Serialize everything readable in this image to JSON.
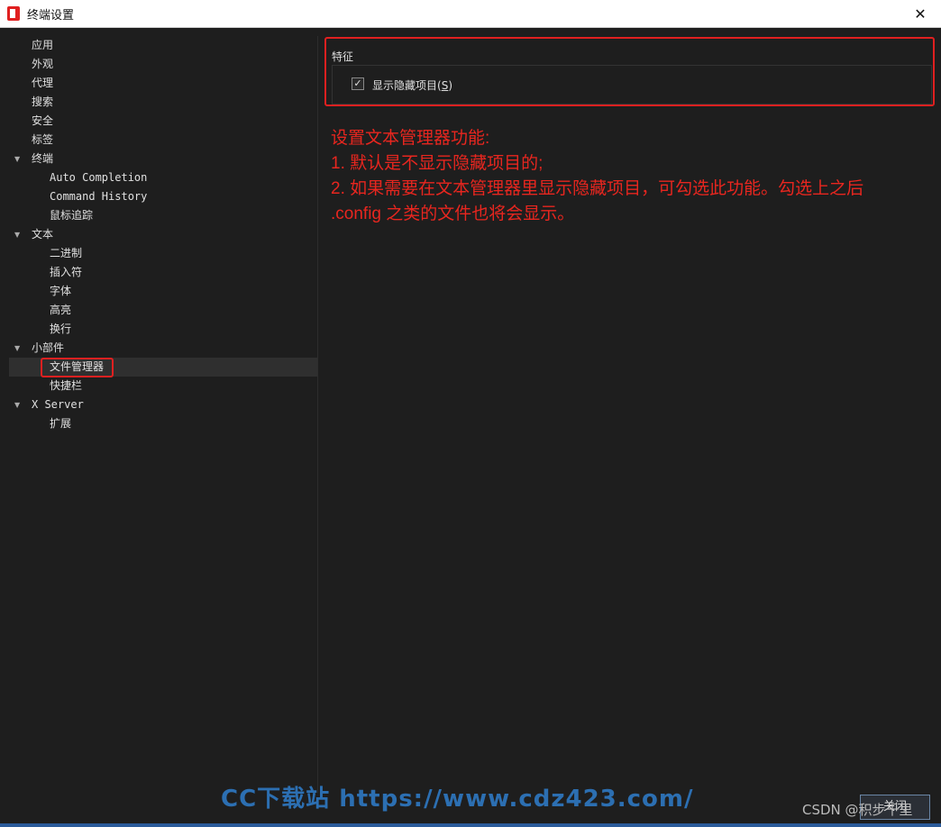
{
  "window": {
    "title": "终端设置",
    "close_glyph": "✕"
  },
  "sidebar": {
    "items": [
      {
        "label": "应用",
        "level": 0,
        "expandable": false
      },
      {
        "label": "外观",
        "level": 0,
        "expandable": false
      },
      {
        "label": "代理",
        "level": 0,
        "expandable": false
      },
      {
        "label": "搜索",
        "level": 0,
        "expandable": false
      },
      {
        "label": "安全",
        "level": 0,
        "expandable": false
      },
      {
        "label": "标签",
        "level": 0,
        "expandable": false
      },
      {
        "label": "终端",
        "level": 0,
        "expandable": true
      },
      {
        "label": "Auto Completion",
        "level": 1,
        "expandable": false
      },
      {
        "label": "Command History",
        "level": 1,
        "expandable": false
      },
      {
        "label": "鼠标追踪",
        "level": 1,
        "expandable": false
      },
      {
        "label": "文本",
        "level": 0,
        "expandable": true
      },
      {
        "label": "二进制",
        "level": 1,
        "expandable": false
      },
      {
        "label": "插入符",
        "level": 1,
        "expandable": false
      },
      {
        "label": "字体",
        "level": 1,
        "expandable": false
      },
      {
        "label": "高亮",
        "level": 1,
        "expandable": false
      },
      {
        "label": "换行",
        "level": 1,
        "expandable": false
      },
      {
        "label": "小部件",
        "level": 0,
        "expandable": true
      },
      {
        "label": "文件管理器",
        "level": 1,
        "expandable": false,
        "selected": true
      },
      {
        "label": "快捷栏",
        "level": 1,
        "expandable": false
      },
      {
        "label": "X Server",
        "level": 0,
        "expandable": true
      },
      {
        "label": "扩展",
        "level": 1,
        "expandable": false
      }
    ],
    "expand_glyph": "▼"
  },
  "main": {
    "feature_title": "特征",
    "show_hidden": {
      "label": "显示隐藏项目(",
      "mnemonic": "S",
      "label_end": ")",
      "checked": true,
      "check_glyph": "✓"
    },
    "annotation": [
      "设置文本管理器功能:",
      "1. 默认是不显示隐藏项目的;",
      "2. 如果需要在文本管理器里显示隐藏项目，可勾选此功能。勾选上之后",
      ".config 之类的文件也将会显示。"
    ],
    "annotation_color": "#e8261f"
  },
  "footer": {
    "watermark": "CC下载站 https://www.cdz423.com/",
    "csdn_mark": "CSDN @积步千里",
    "close_button": "关闭"
  },
  "colors": {
    "background": "#1e1e1e",
    "highlight_border": "#e02020",
    "selected_row": "#2f2f2f"
  }
}
